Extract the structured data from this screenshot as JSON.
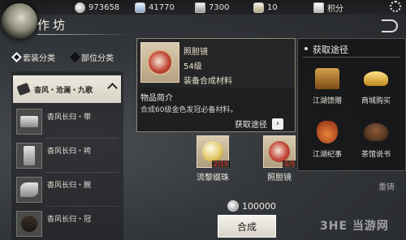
{
  "resources": [
    {
      "icon": "coin-icon",
      "value": "973658"
    },
    {
      "icon": "jade-icon",
      "value": "41770"
    },
    {
      "icon": "silver-icon",
      "value": "7300"
    },
    {
      "icon": "pouch-icon",
      "value": "10"
    },
    {
      "icon": "score-icon",
      "value": "积分"
    }
  ],
  "header": {
    "title": "作坊"
  },
  "category_tabs": [
    "套装分类",
    "部位分类"
  ],
  "set_list": {
    "group_name": "杳风・沧澜・九歌",
    "items": [
      {
        "name": "杳风长归・带"
      },
      {
        "name": "杳风长归・袴"
      },
      {
        "name": "杳风长归・腕"
      },
      {
        "name": "杳风长归・冠"
      }
    ]
  },
  "detail": {
    "name": "照胆镜",
    "level": "54级",
    "type": "装备合成材料",
    "section_title": "物品简介",
    "description": "合成60级金色发冠必备材料。",
    "source_label": "获取途径"
  },
  "source_panel": {
    "title": "获取途径",
    "items": [
      {
        "label": "江湖馈赠",
        "icon": "chest-icon"
      },
      {
        "label": "商城购买",
        "icon": "ingot-icon"
      },
      {
        "label": "江湖纪事",
        "icon": "pouch-icon"
      },
      {
        "label": "茶馆说书",
        "icon": "teapot-icon"
      }
    ]
  },
  "materials": [
    {
      "name": "流黎缀珠",
      "count": "2/15"
    },
    {
      "name": "照胆镜",
      "count": "0/5"
    }
  ],
  "cost": "100000",
  "craft_label": "合成",
  "side_label": "重铸",
  "watermark": "3HE 当游网"
}
